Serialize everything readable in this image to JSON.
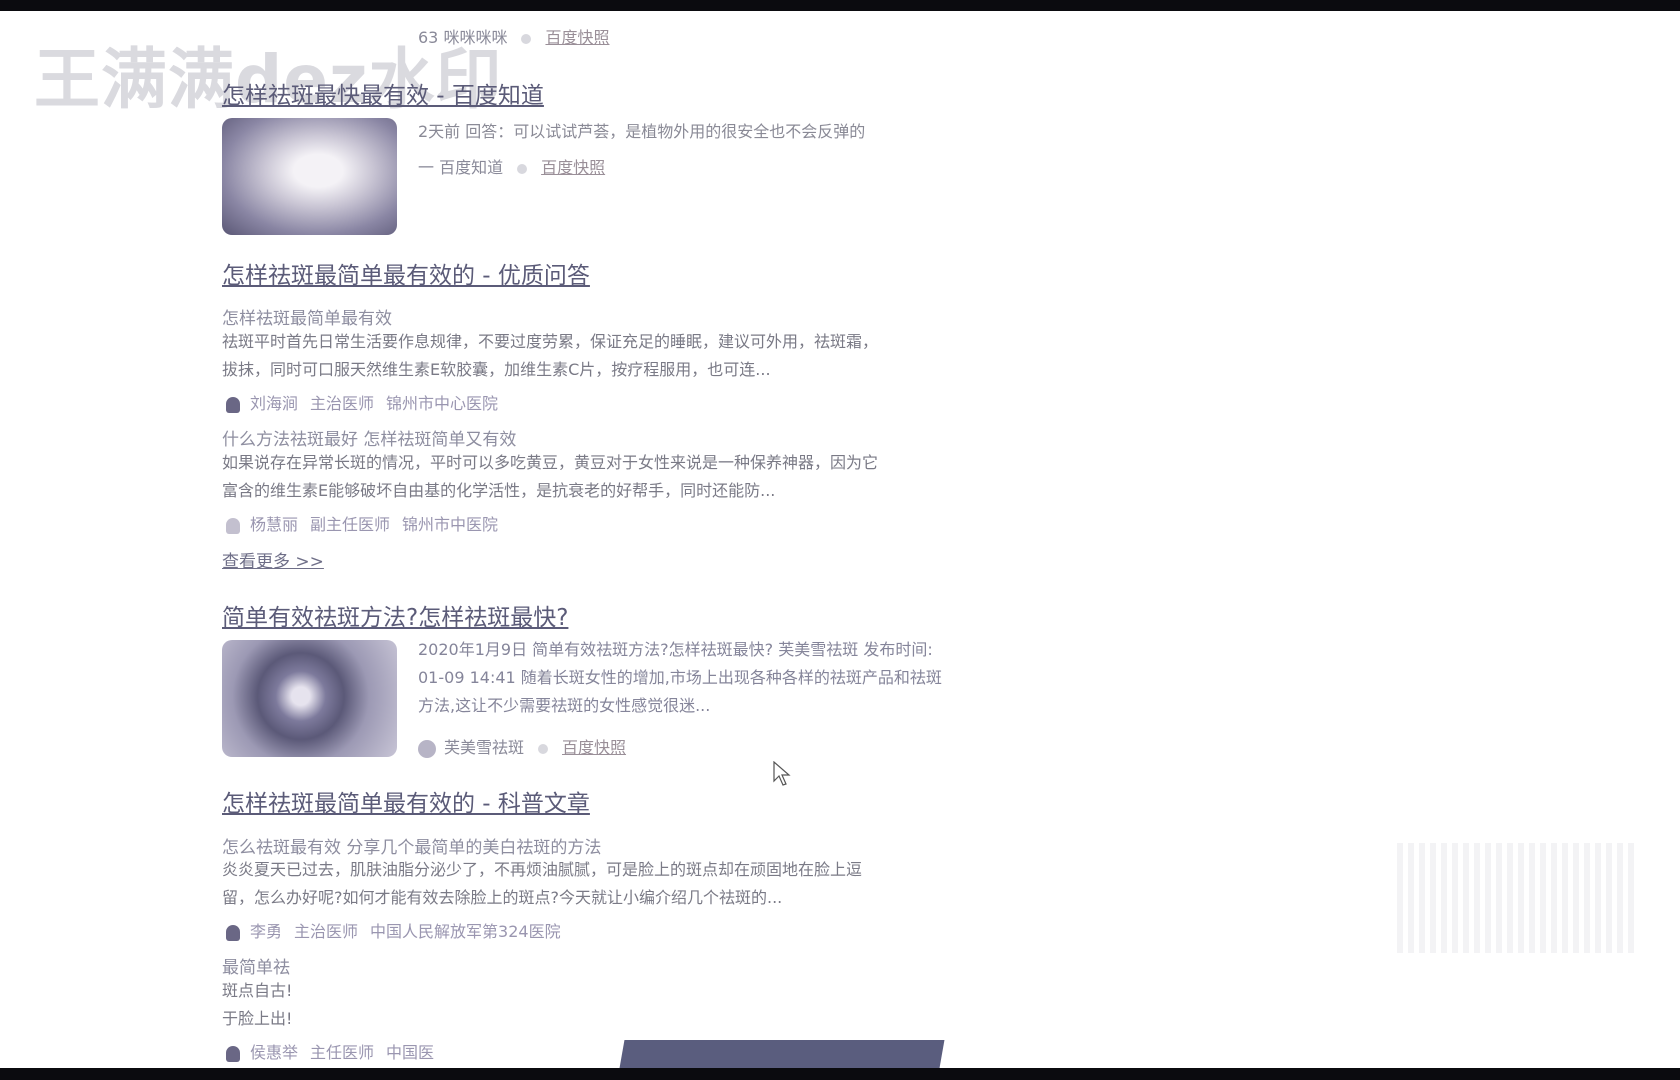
{
  "watermark": "王满满dez水印",
  "top_partial": {
    "meta": "63 咪咪咪咪",
    "link": "百度快照"
  },
  "results": [
    {
      "title": "怎样祛斑最快最有效 - 百度知道",
      "snippet": "2天前 回答：可以试试芦荟，是植物外用的很安全也不会反弹的",
      "source": "一 百度知道",
      "link": "百度快照"
    },
    {
      "title": "怎样祛斑最简单最有效的 - 优质问答",
      "qa": [
        {
          "question": "怎样祛斑最简单最有效",
          "answer_line1": "祛斑平时首先日常生活要作息规律，不要过度劳累，保证充足的睡眠，建议可外用，祛斑霜，",
          "answer_line2": "拔抹，同时可口服天然维生素E软胶囊，加维生素C片，按疗程服用，也可连...",
          "author": "刘海涧",
          "title": "主治医师",
          "hospital": "锦州市中心医院"
        },
        {
          "question": "什么方法祛斑最好 怎样祛斑简单又有效",
          "answer_line1": "如果说存在异常长斑的情况，平时可以多吃黄豆，黄豆对于女性来说是一种保养神器，因为它",
          "answer_line2": "富含的维生素E能够破坏自由基的化学活性，是抗衰老的好帮手，同时还能防...",
          "author": "杨慧丽",
          "title": "副主任医师",
          "hospital": "锦州市中医院"
        }
      ],
      "more": "查看更多 >>"
    },
    {
      "title": "简单有效祛斑方法?怎样祛斑最快?",
      "line1": "2020年1月9日 简单有效祛斑方法?怎样祛斑最快? 芙美雪祛斑 发布时间:",
      "line2": "01-09 14:41 随着长斑女性的增加,市场上出现各种各样的祛斑产品和祛斑",
      "line3": "方法,这让不少需要祛斑的女性感觉很迷...",
      "source": "芙美雪祛斑",
      "link": "百度快照"
    },
    {
      "title": "怎样祛斑最简单最有效的 - 科普文章",
      "qa": [
        {
          "question": "怎么祛斑最有效 分享几个最简单的美白祛斑的方法",
          "answer_line1": "炎炎夏天已过去，肌肤油脂分泌少了，不再烦油腻腻，可是脸上的斑点却在顽固地在脸上逗",
          "answer_line2": "留，怎么办好呢?如何才能有效去除脸上的斑点?今天就让小编介绍几个祛斑的...",
          "author": "李勇",
          "title": "主治医师",
          "hospital": "中国人民解放军第324医院"
        }
      ],
      "extra": {
        "heading": "最简单祛",
        "line1": "斑点自古!",
        "line2": "于脸上出!",
        "author": "侯惠举",
        "title": "主任医师",
        "hospital": "中国医"
      }
    }
  ]
}
